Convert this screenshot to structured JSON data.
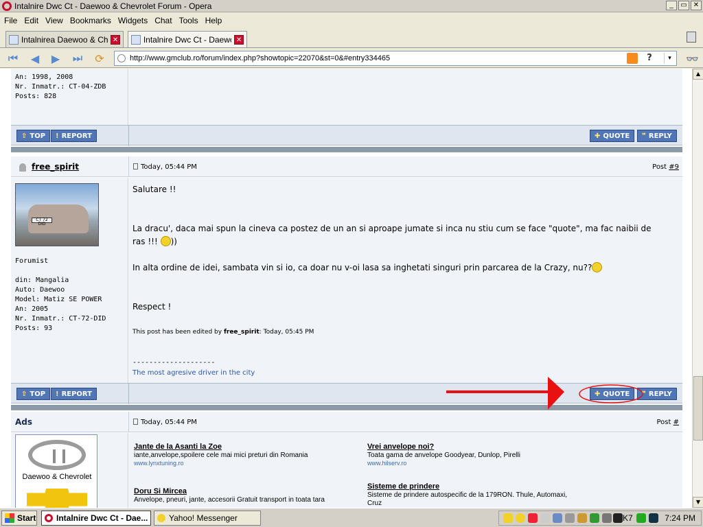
{
  "window": {
    "title": "Intalnire Dwc Ct - Daewoo & Chevrolet Forum - Opera",
    "min": "_",
    "restore": "▭",
    "close": "✕"
  },
  "menu": [
    "File",
    "Edit",
    "View",
    "Bookmarks",
    "Widgets",
    "Chat",
    "Tools",
    "Help"
  ],
  "tabs": [
    {
      "label": "Intalnirea Daewoo & Che...",
      "close": "✕"
    },
    {
      "label": "Intalnire Dwc Ct - Daewo...",
      "close": "✕"
    }
  ],
  "address": {
    "url": "http://www.gmclub.ro/forum/index.php?showtopic=22070&st=0&#entry334465",
    "help": "?",
    "dropdown": "▾"
  },
  "prev_post_info": {
    "partial_line": "An: 1998, 2008",
    "plate": "Nr. Inmatr.: CT-04-ZDB",
    "posts": "Posts: 828"
  },
  "buttons": {
    "top": "TOP",
    "report": "REPORT",
    "quote": "QUOTE",
    "reply": "REPLY"
  },
  "post": {
    "author": "free_spirit",
    "date": "Today, 05:44 PM",
    "post_label": "Post ",
    "post_number": "#9",
    "role": "Forumist",
    "location": "din: Mangalia",
    "auto": "Auto: Daewoo",
    "model": "Model: Matiz SE POWER",
    "year": "An: 2005",
    "plate": "Nr. Inmatr.: CT-72-DID",
    "posts": "Posts: 93",
    "avatar_plate": "CT 72 DID",
    "lines": {
      "greeting": "Salutare !!",
      "para1_a": "La dracu', daca mai spun la cineva ca postez de un an si aproape jumate si inca nu stiu cum se face \"quote\", ma fac naibii de",
      "para1_b": "ras !!! ",
      "para1_c": "))",
      "para2": "In alta ordine de idei, sambata vin si io, ca doar nu v-oi lasa sa inghetati singuri prin parcarea de la Crazy, nu??",
      "closing": "Respect !",
      "edited_prefix": "This post has been edited by ",
      "edited_by": "free_spirit",
      "edited_time": ": Today, 05:45 PM",
      "sig_line": "--------------------",
      "signature": "The most agresive driver in the city"
    }
  },
  "ads": {
    "title": "Ads",
    "date": "Today, 05:44 PM",
    "post_label": "Post ",
    "post_number": "#",
    "logo_text": "Daewoo & Chevrolet",
    "items": [
      {
        "title": "Jante de la Asanti la Zoe",
        "desc": "iante,anvelope,spoilere cele mai mici preturi din Romania",
        "url": "www.lynxtuning.ro"
      },
      {
        "title": "Vrei anvelope noi?",
        "desc": "Toata gama de anvelope Goodyear, Dunlop, Pirelli",
        "url": "www.hilserv.ro"
      },
      {
        "title": "Doru Si Mircea",
        "desc": "Anvelope, pneuri, jante, accesorii Gratuit transport in toata tara",
        "url": ""
      },
      {
        "title": "Sisteme de prindere",
        "desc": "Sisteme de prindere autospecific de la 179RON. Thule, Automaxi,",
        "desc2": "Cruz",
        "url": ""
      }
    ]
  },
  "annotation": {
    "arrow_color": "#e81010"
  },
  "taskbar": {
    "start": "Start",
    "items": [
      {
        "label": "Intalnire Dwc Ct - Dae..."
      },
      {
        "label": "Yahoo! Messenger"
      }
    ],
    "tray_text": "K7",
    "clock": "7:24 PM"
  },
  "colors": {
    "button_blue": "#5176b5",
    "post_bg": "#f0f3f7",
    "bar_bg": "#dfe6ef",
    "separator": "#8c9aa8"
  }
}
